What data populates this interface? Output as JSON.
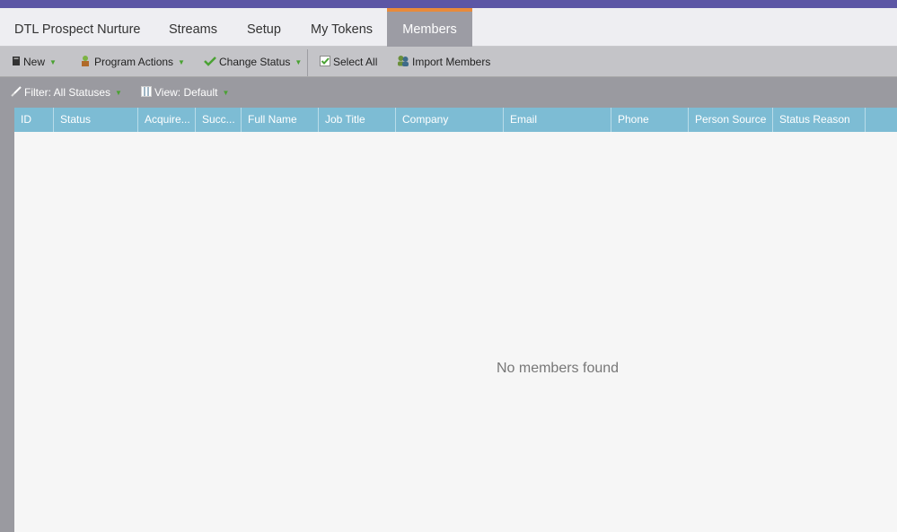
{
  "tabs": [
    {
      "label": "DTL Prospect Nurture"
    },
    {
      "label": "Streams"
    },
    {
      "label": "Setup"
    },
    {
      "label": "My Tokens"
    },
    {
      "label": "Members"
    }
  ],
  "toolbar": {
    "new_label": "New",
    "program_actions_label": "Program Actions",
    "change_status_label": "Change Status",
    "select_all_label": "Select All",
    "import_members_label": "Import Members"
  },
  "filterbar": {
    "filter_label": "Filter: All Statuses",
    "view_label": "View: Default"
  },
  "grid": {
    "columns": [
      "ID",
      "Status",
      "Acquire...",
      "Succ...",
      "Full Name",
      "Job Title",
      "Company",
      "Email",
      "Phone",
      "Person Source",
      "Status Reason",
      ""
    ],
    "empty_message": "No members found"
  },
  "colors": {
    "accent_bar": "#5c56a5",
    "active_tab_border": "#e98a3a",
    "header_blue": "#7dbcd4"
  }
}
